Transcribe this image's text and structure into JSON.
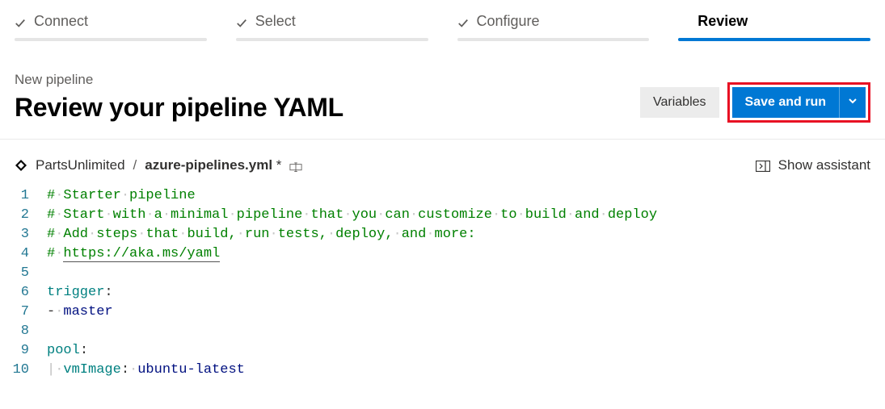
{
  "steps": {
    "items": [
      {
        "label": "Connect",
        "done": true,
        "active": false
      },
      {
        "label": "Select",
        "done": true,
        "active": false
      },
      {
        "label": "Configure",
        "done": true,
        "active": false
      },
      {
        "label": "Review",
        "done": false,
        "active": true
      }
    ]
  },
  "header": {
    "subtitle": "New pipeline",
    "title": "Review your pipeline YAML",
    "variables_label": "Variables",
    "save_run_label": "Save and run"
  },
  "path": {
    "project": "PartsUnlimited",
    "separator": "/",
    "filename": "azure-pipelines.yml",
    "dirty_marker": "*"
  },
  "assistant": {
    "label": "Show assistant"
  },
  "editor": {
    "lines": [
      {
        "n": 1,
        "tokens": [
          [
            "comment",
            "# Starter pipeline"
          ]
        ]
      },
      {
        "n": 2,
        "tokens": [
          [
            "comment",
            "# Start with a minimal pipeline that you can customize to build and deploy"
          ]
        ]
      },
      {
        "n": 3,
        "tokens": [
          [
            "comment",
            "# Add steps that build, run tests, deploy, and more:"
          ]
        ]
      },
      {
        "n": 4,
        "tokens": [
          [
            "comment",
            "# "
          ],
          [
            "url",
            "https://aka.ms/yaml"
          ]
        ]
      },
      {
        "n": 5,
        "tokens": []
      },
      {
        "n": 6,
        "tokens": [
          [
            "key",
            "trigger"
          ],
          [
            "punct",
            ":"
          ]
        ]
      },
      {
        "n": 7,
        "tokens": [
          [
            "punct",
            "- "
          ],
          [
            "ident",
            "master"
          ]
        ]
      },
      {
        "n": 8,
        "tokens": []
      },
      {
        "n": 9,
        "tokens": [
          [
            "key",
            "pool"
          ],
          [
            "punct",
            ":"
          ]
        ]
      },
      {
        "n": 10,
        "indent": 2,
        "tokens": [
          [
            "key",
            "vmImage"
          ],
          [
            "punct",
            ": "
          ],
          [
            "ident",
            "ubuntu-latest"
          ]
        ]
      }
    ]
  }
}
